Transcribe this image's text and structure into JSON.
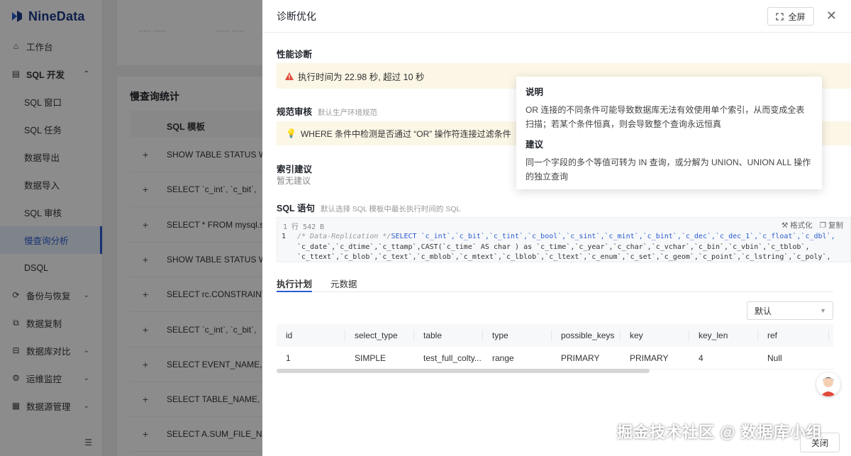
{
  "sidebar": {
    "logo_text": "NineData",
    "items": [
      {
        "label": "工作台",
        "icon": "home-icon",
        "type": "top"
      },
      {
        "label": "SQL 开发",
        "icon": "sql-icon",
        "type": "group",
        "expanded": true
      },
      {
        "label": "SQL 窗口",
        "type": "sub"
      },
      {
        "label": "SQL 任务",
        "type": "sub"
      },
      {
        "label": "数据导出",
        "type": "sub"
      },
      {
        "label": "数据导入",
        "type": "sub"
      },
      {
        "label": "SQL 审核",
        "type": "sub"
      },
      {
        "label": "慢查询分析",
        "type": "sub",
        "active": true
      },
      {
        "label": "DSQL",
        "type": "sub"
      },
      {
        "label": "备份与恢复",
        "icon": "backup-icon",
        "type": "top",
        "chevron": true
      },
      {
        "label": "数据复制",
        "icon": "replicate-icon",
        "type": "top"
      },
      {
        "label": "数据库对比",
        "icon": "compare-icon",
        "type": "top",
        "chevron": true
      },
      {
        "label": "运维监控",
        "icon": "monitor-icon",
        "type": "top",
        "chevron": true
      },
      {
        "label": "数据源管理",
        "icon": "datasource-icon",
        "type": "top",
        "chevron": true
      }
    ]
  },
  "background": {
    "card_title": "慢查询统计",
    "column_header": "SQL 模板",
    "rows": [
      "SHOW TABLE STATUS WH",
      "SELECT `c_int`, `c_bit`,",
      "SELECT * FROM mysql.slo",
      "SHOW TABLE STATUS WH",
      "SELECT rc.CONSTRAINT_",
      "SELECT `c_int`, `c_bit`,",
      "SELECT EVENT_NAME, ro",
      "SELECT TABLE_NAME, PA",
      "SELECT A.SUM_FILE_NA"
    ]
  },
  "drawer": {
    "title": "诊断优化",
    "fullscreen_label": "全屏",
    "perf_title": "性能诊断",
    "perf_warning": "执行时间为 22.98 秒, 超过 10 秒",
    "norm_title": "规范审核",
    "norm_subtitle": "默认生产环境规范",
    "norm_tip": "WHERE 条件中检测是否通过 “OR” 操作符连接过滤条件",
    "index_title": "索引建议",
    "index_none": "暂无建议",
    "sql_title": "SQL 语句",
    "sql_subtitle": "默认选择 SQL 模板中最长执行时间的 SQL",
    "code_meta": "1 行   542 B",
    "format_label": "格式化",
    "copy_label": "复制",
    "code_line_no": "1",
    "code_comment": "/* Data-Replication */",
    "code_line1_rest": "SELECT `c_int`,`c_bit`,`c_tint`,`c_bool`,`c_sint`,`c_mint`,`c_bint`,`c_dec`,`c_dec_1`,`c_float`,`c_dbl`,",
    "code_line2": "`c_date`,`c_dtime`,`c_ttamp`,CAST(`c_time` AS char ) as `c_time`,`c_year`,`c_char`,`c_vchar`,`c_bin`,`c_vbin`,`c_tblob`,",
    "code_line3": "`c_ttext`,`c_blob`,`c_text`,`c_mblob`,`c_mtext`,`c_lblob`,`c_ltext`,`c_enum`,`c_set`,`c_geom`,`c_point`,`c_lstring`,`c_poly`,",
    "tabs": [
      "执行计划",
      "元数据"
    ],
    "select_value": "默认",
    "plan_columns": [
      "id",
      "select_type",
      "table",
      "type",
      "possible_keys",
      "key",
      "key_len",
      "ref"
    ],
    "plan_rows": [
      [
        "1",
        "SIMPLE",
        "test_full_colty...",
        "range",
        "PRIMARY",
        "PRIMARY",
        "4",
        "Null"
      ]
    ]
  },
  "popover": {
    "desc_title": "说明",
    "desc_text": "OR 连接的不同条件可能导致数据库无法有效使用单个索引，从而变成全表扫描；若某个条件恒真，则会导致整个查询永远恒真",
    "suggest_title": "建议",
    "suggest_text": "同一个字段的多个等值可转为 IN 查询，或分解为 UNION、UNION ALL 操作的独立查询"
  },
  "footer": {
    "close_label": "关闭",
    "watermark": "掘金技术社区 @ 数据库小组"
  },
  "colors": {
    "accent": "#2b5ccf",
    "warn_bg": "#fcf6e6",
    "warn_icon": "#e04a3a"
  }
}
